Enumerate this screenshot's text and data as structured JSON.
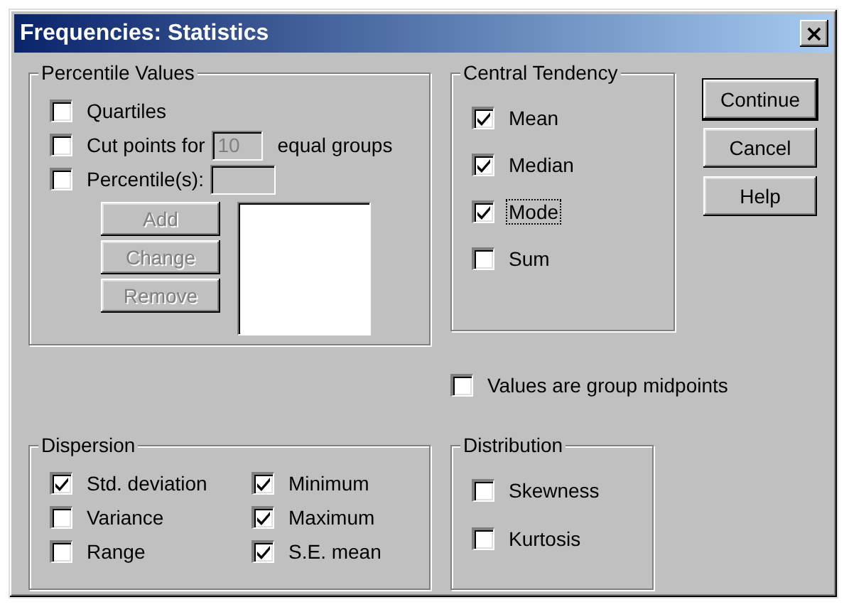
{
  "window": {
    "title": "Frequencies: Statistics",
    "close": "×"
  },
  "percentile_values": {
    "title": "Percentile Values",
    "quartiles": {
      "label": "Quartiles",
      "checked": false
    },
    "cut_points": {
      "label": "Cut points for",
      "checked": false,
      "value": "10",
      "disabled": true,
      "suffix": "equal groups"
    },
    "percentiles": {
      "label": "Percentile(s):",
      "checked": false,
      "disabled": true
    },
    "buttons": [
      {
        "label": "Add",
        "disabled": true
      },
      {
        "label": "Change",
        "disabled": true
      },
      {
        "label": "Remove",
        "disabled": true
      }
    ]
  },
  "central_tendency": {
    "title": "Central Tendency",
    "items": [
      {
        "label": "Mean",
        "checked": true,
        "focused": false
      },
      {
        "label": "Median",
        "checked": true,
        "focused": false
      },
      {
        "label": "Mode",
        "checked": true,
        "focused": true
      },
      {
        "label": "Sum",
        "checked": false,
        "focused": false
      }
    ]
  },
  "buttons": [
    {
      "label": "Continue",
      "default": true
    },
    {
      "label": "Cancel",
      "default": false
    },
    {
      "label": "Help",
      "default": false
    }
  ],
  "group_midpoints": {
    "label": "Values are group midpoints",
    "checked": false
  },
  "dispersion": {
    "title": "Dispersion",
    "items": [
      {
        "label": "Std. deviation",
        "checked": true
      },
      {
        "label": "Minimum",
        "checked": true
      },
      {
        "label": "Variance",
        "checked": false
      },
      {
        "label": "Maximum",
        "checked": true
      },
      {
        "label": "Range",
        "checked": false
      },
      {
        "label": "S.E. mean",
        "checked": true
      }
    ]
  },
  "distribution": {
    "title": "Distribution",
    "items": [
      {
        "label": "Skewness",
        "checked": false
      },
      {
        "label": "Kurtosis",
        "checked": false
      }
    ]
  }
}
